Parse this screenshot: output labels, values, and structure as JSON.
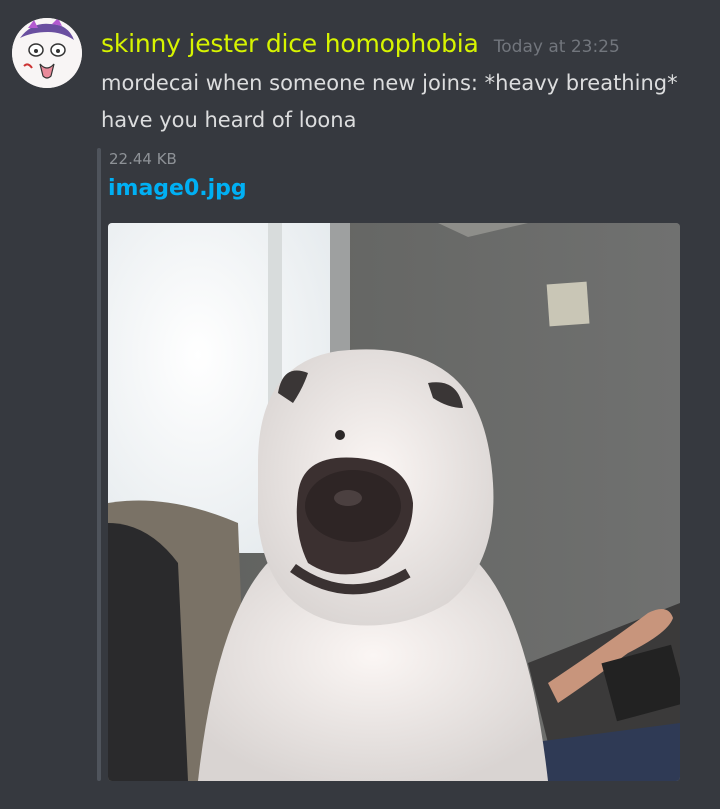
{
  "message": {
    "author": "skinny jester dice homophobia",
    "timestamp": "Today at 23:25",
    "lines": [
      "mordecai when someone new joins: *heavy breathing*",
      "have you heard of loona"
    ]
  },
  "attachment": {
    "size": "22.44 KB",
    "filename": "image0.jpg",
    "image_alt": "image0.jpg"
  },
  "theme": {
    "background": "#36393f",
    "username_color": "#d7f400",
    "link_color": "#00b0f4",
    "timestamp_color": "#72767d",
    "text_color": "#dcddde"
  }
}
